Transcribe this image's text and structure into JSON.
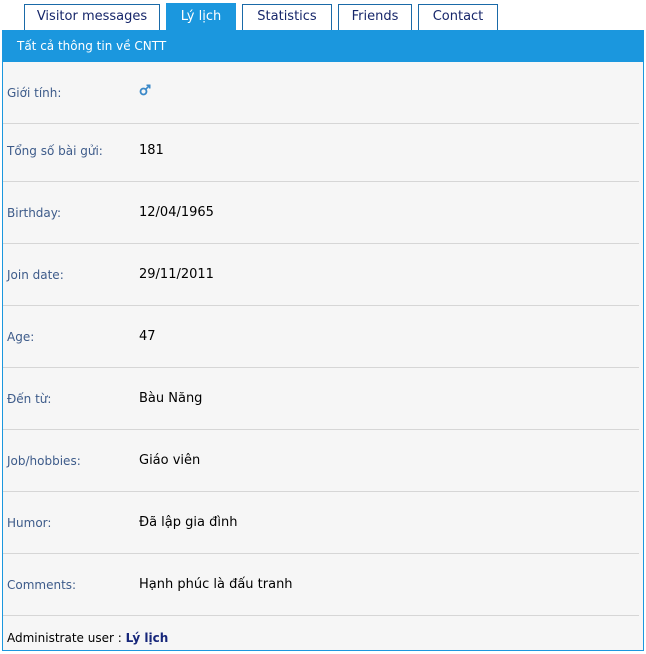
{
  "tabs": [
    {
      "label": "Visitor messages",
      "active": false
    },
    {
      "label": "Lý lịch",
      "active": true
    },
    {
      "label": "Statistics",
      "active": false
    },
    {
      "label": "Friends",
      "active": false
    },
    {
      "label": "Contact",
      "active": false
    }
  ],
  "panel": {
    "header": "Tất cả thông tin về CNTT"
  },
  "profile": {
    "gender": {
      "label": "Giới tính:",
      "icon": "male-gender-icon"
    },
    "posts": {
      "label": "Tổng số bài gửi:",
      "value": "181"
    },
    "birthday": {
      "label": "Birthday:",
      "value": "12/04/1965"
    },
    "join_date": {
      "label": "Join date:",
      "value": "29/11/2011"
    },
    "age": {
      "label": "Age:",
      "value": "47"
    },
    "from": {
      "label": "Đến từ:",
      "value": "Bàu Năng"
    },
    "job": {
      "label": "Job/hobbies:",
      "value": "Giáo viên"
    },
    "humor": {
      "label": "Humor:",
      "value": "Đã lập gia đình"
    },
    "comments": {
      "label": "Comments:",
      "value": "Hạnh phúc là đấu tranh"
    }
  },
  "admin": {
    "label": "Administrate user :",
    "link": "Lý lịch"
  },
  "colors": {
    "accent": "#1b97de",
    "tab_border": "#1a6aa8",
    "tab_text": "#16266a",
    "label_text": "#3d5b8a",
    "panel_bg": "#f6f6f6"
  }
}
